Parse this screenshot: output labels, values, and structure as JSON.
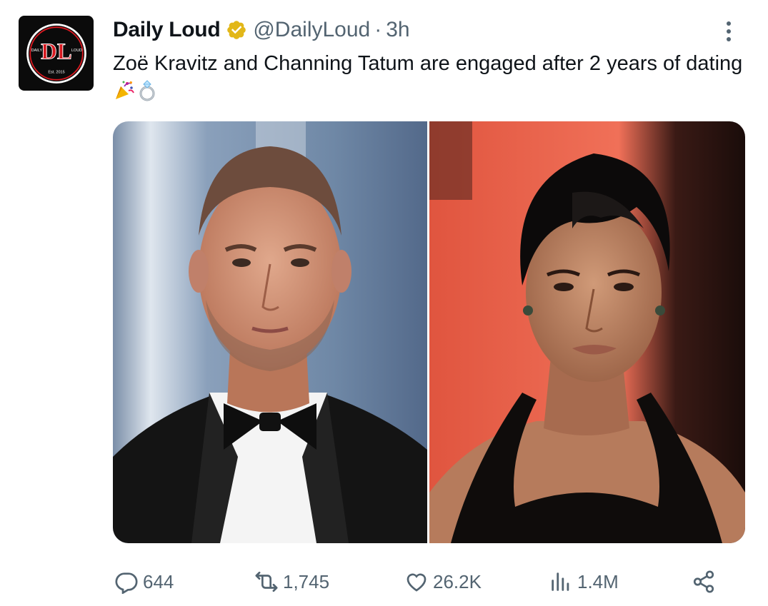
{
  "tweet": {
    "display_name": "Daily Loud",
    "handle": "@DailyLoud",
    "separator": "·",
    "time": "3h",
    "text": "Zoë Kravitz and Channing Tatum are engaged after 2 years of dating",
    "emojis": [
      "party-popper-icon",
      "ring-icon"
    ],
    "avatar": {
      "logo_letters": "DL",
      "left_text": "DAILY",
      "right_text": "LOUD",
      "bottom_text": "Est. 2015"
    }
  },
  "actions": {
    "replies": "644",
    "retweets": "1,745",
    "likes": "26.2K",
    "views": "1.4M"
  },
  "colors": {
    "text_primary": "#0f1419",
    "text_secondary": "#536471",
    "verified_gold": "#e2b719",
    "logo_red": "#d71920"
  }
}
